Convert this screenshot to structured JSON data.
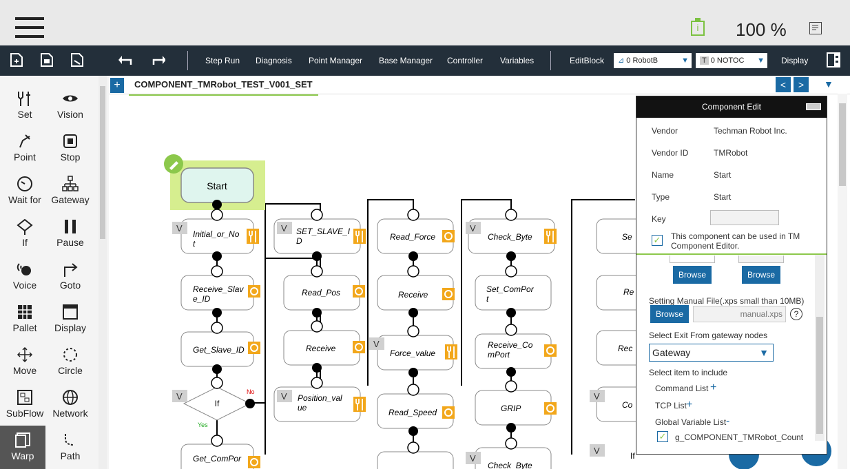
{
  "statusbar": {
    "speed": "100 %",
    "battery_label": "i"
  },
  "toolbar": {
    "step_run": "Step Run",
    "diagnosis": "Diagnosis",
    "point_manager": "Point Manager",
    "base_manager": "Base Manager",
    "controller": "Controller",
    "variables": "Variables",
    "editblock": "EditBlock",
    "robot_base": "0 RobotB ",
    "tool": "0 NOTOC",
    "tool_prefix": "T",
    "display": "Display"
  },
  "tools": {
    "set": "Set",
    "vision": "Vision",
    "point": "Point",
    "stop": "Stop",
    "waitfor": "Wait for",
    "gateway": "Gateway",
    "if": "If",
    "pause": "Pause",
    "voice": "Voice",
    "goto": "Goto",
    "pallet": "Pallet",
    "display": "Display",
    "move": "Move",
    "circle": "Circle",
    "subflow": "SubFlow",
    "network": "Network",
    "warp": "Warp",
    "path": "Path"
  },
  "tab": {
    "plus": "+",
    "name": "COMPONENT_TMRobot_TEST_V001_SET",
    "prev": "<",
    "next": ">",
    "dropdown": "▼"
  },
  "flow": {
    "start": "Start",
    "v": "V",
    "col1": [
      "Initial_or_No",
      "t",
      "Receive_Slav",
      "e_ID",
      "Get_Slave_ID",
      "If",
      "Get_ComPor"
    ],
    "col2": [
      "SET_SLAVE_I",
      "D",
      "Read_Pos",
      "Receive",
      "Position_val",
      "ue"
    ],
    "col3": [
      "Read_Force",
      "Receive",
      "Force_value",
      "Read_Speed"
    ],
    "col4": [
      "Check_Byte",
      "Set_ComPor",
      "t",
      "Receive_Co",
      "mPort",
      "GRIP",
      "Check_Byte"
    ],
    "col5": [
      "Se",
      "Re",
      "Rec",
      "Co",
      "If"
    ],
    "no": "No",
    "yes": "Yes"
  },
  "component_edit": {
    "title": "Component Edit",
    "vendor_label": "Vendor",
    "vendor": "Techman Robot Inc.",
    "vendor_id_label": "Vendor ID",
    "vendor_id": "TMRobot",
    "name_label": "Name",
    "name": "Start",
    "type_label": "Type",
    "type": "Start",
    "key_label": "Key",
    "editor_check": "This component can be used in TM Component Editor.",
    "browse": "Browse",
    "manual_label": "Setting Manual File(.xps small than 10MB)",
    "manual_file": "manual.xps",
    "help": "?",
    "exit_label": "Select Exit From gateway nodes",
    "exit_value": "Gateway",
    "include_label": "Select item to include",
    "command_list": "Command List",
    "tcp_list": "TCP List",
    "global_list": "Global Variable List",
    "plus": "+",
    "minus": "-",
    "global_item": "g_COMPONENT_TMRobot_Count"
  }
}
